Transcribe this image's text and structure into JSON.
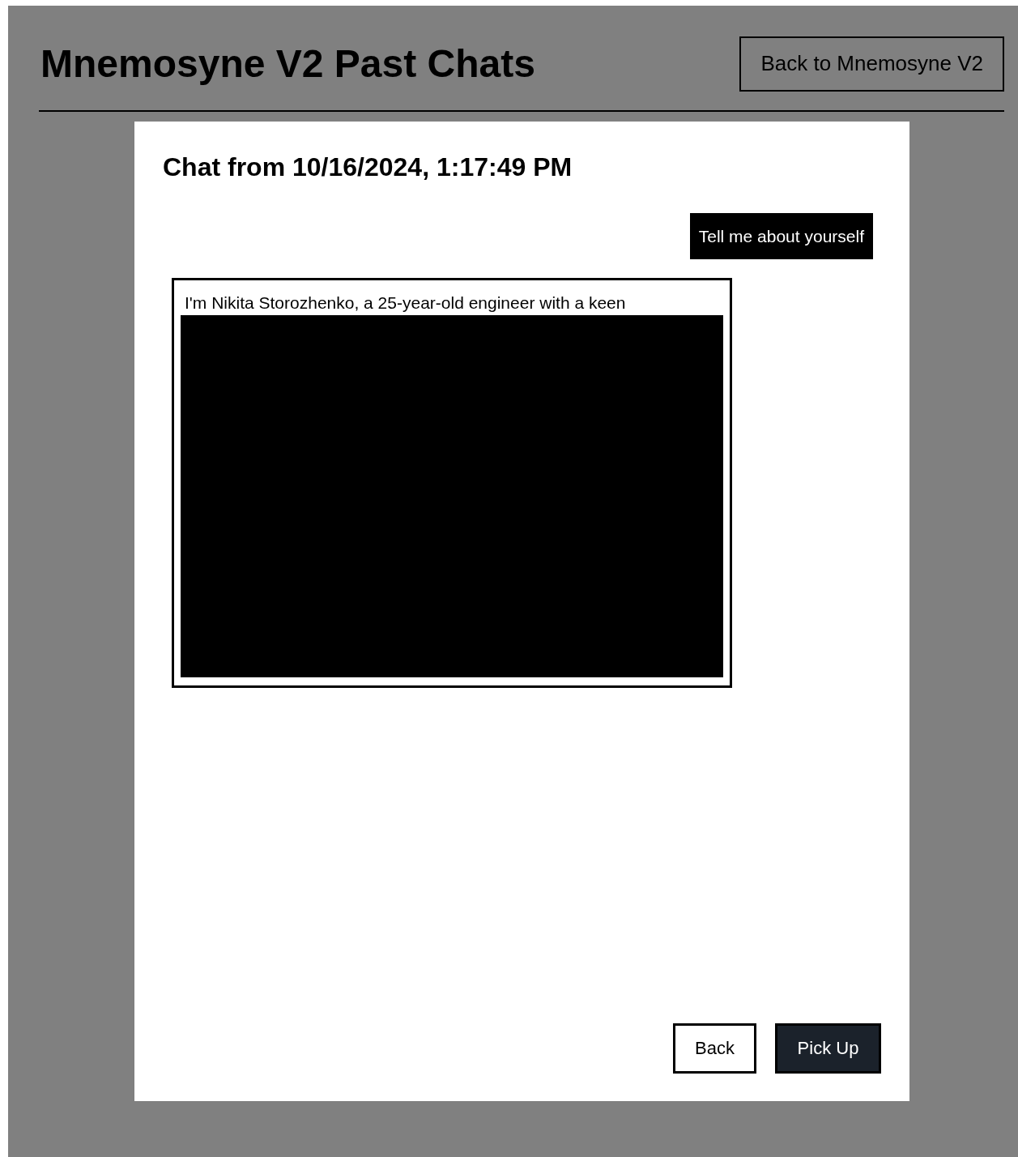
{
  "header": {
    "title": "Mnemosyne V2 Past Chats",
    "back_link": "Back to Mnemosyne V2"
  },
  "chat": {
    "title": "Chat from 10/16/2024, 1:17:49 PM",
    "messages": [
      {
        "kind": "user",
        "text": "Tell me about yourself"
      },
      {
        "kind": "assistant",
        "text": "I'm Nikita Storozhenko, a 25-year-old engineer with a keen",
        "redacted": true
      }
    ]
  },
  "buttons": [
    {
      "kind": "secondary",
      "label": "Back"
    },
    {
      "kind": "primary",
      "label": "Pick Up"
    }
  ]
}
